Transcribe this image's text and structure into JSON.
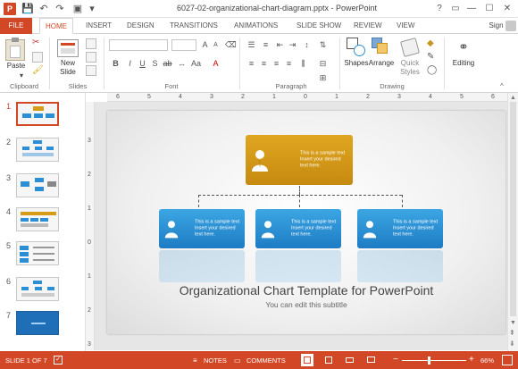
{
  "titlebar": {
    "app_letter": "P",
    "doc_title": "6027-02-organizational-chart-diagram.pptx - PowerPoint",
    "qa_icons": [
      "save-icon",
      "undo-icon",
      "redo-icon",
      "slideshow-from-start-icon",
      "customize-icon"
    ],
    "window_buttons": [
      "?",
      "▭",
      "—",
      "☐",
      "✕"
    ]
  },
  "tabs": {
    "file": "FILE",
    "items": [
      "HOME",
      "INSERT",
      "DESIGN",
      "TRANSITIONS",
      "ANIMATIONS",
      "SLIDE SHOW",
      "REVIEW",
      "VIEW"
    ],
    "signin": "Sign in"
  },
  "ribbon": {
    "clipboard": {
      "label": "Clipboard",
      "paste": "Paste"
    },
    "slides": {
      "label": "Slides",
      "new_slide": "New Slide"
    },
    "font": {
      "label": "Font",
      "font_name": "",
      "font_size": ""
    },
    "paragraph": {
      "label": "Paragraph"
    },
    "drawing": {
      "label": "Drawing",
      "shapes": "Shapes",
      "arrange": "Arrange",
      "quick_styles": "Quick Styles"
    },
    "editing": {
      "label": "Editing"
    }
  },
  "ruler": {
    "h_ticks": [
      "6",
      "5",
      "4",
      "3",
      "2",
      "1",
      "0",
      "1",
      "2",
      "3",
      "4",
      "5",
      "6"
    ],
    "v_ticks": [
      "3",
      "2",
      "1",
      "0",
      "1",
      "2",
      "3"
    ]
  },
  "slides_panel": {
    "numbers": [
      "1",
      "2",
      "3",
      "4",
      "5",
      "6",
      "7"
    ],
    "selected": 1
  },
  "slide": {
    "top_box_text": "This is a sample text Insert your desired text here.",
    "child_box_text": "This is a sample text Insert your desired text here.",
    "title": "Organizational Chart Template for PowerPoint",
    "subtitle": "You can edit this subtitle",
    "colors": {
      "top": "#d69b17",
      "child": "#2a8fd6"
    }
  },
  "statusbar": {
    "slide_info": "SLIDE 1 OF 7",
    "notes": "NOTES",
    "comments": "COMMENTS",
    "zoom_minus": "−",
    "zoom_plus": "+",
    "zoom": "66%",
    "zoom_level": 0.4
  }
}
